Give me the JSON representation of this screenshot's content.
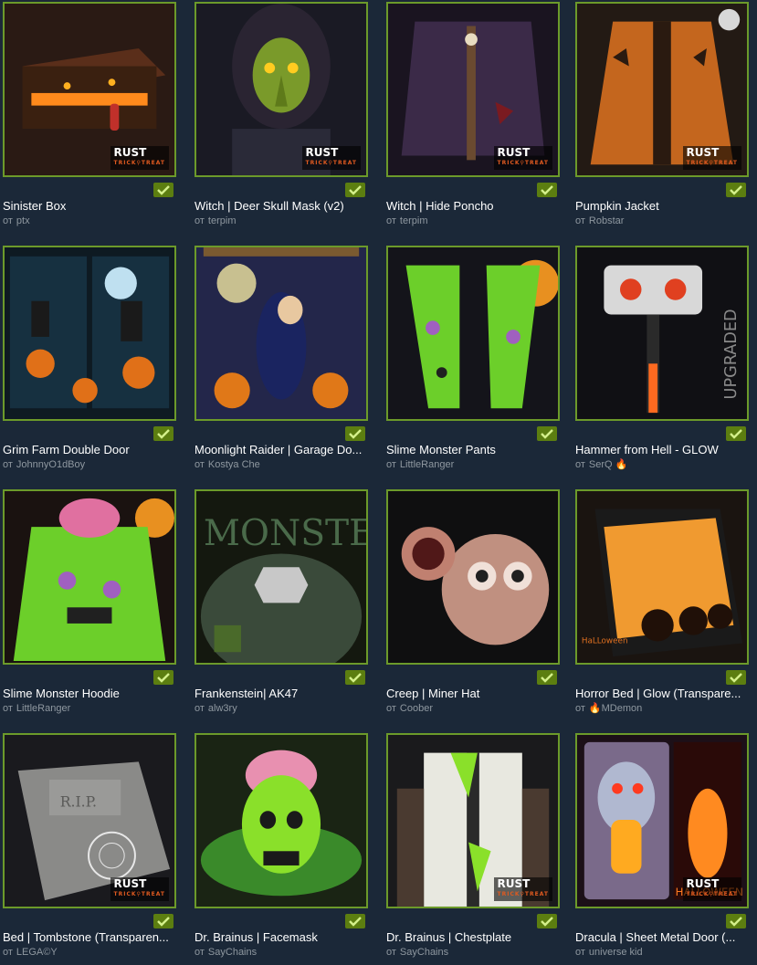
{
  "items": [
    {
      "title": "Sinister Box",
      "by": "от",
      "author": "ptx",
      "flame": "",
      "badge": true,
      "theme": "box"
    },
    {
      "title": "Witch | Deer Skull Mask (v2)",
      "by": "от",
      "author": "terpim",
      "flame": "",
      "badge": true,
      "theme": "witch"
    },
    {
      "title": "Witch | Hide Poncho",
      "by": "от",
      "author": "terpim",
      "flame": "",
      "badge": true,
      "theme": "poncho"
    },
    {
      "title": "Pumpkin Jacket",
      "by": "от",
      "author": "Robstar",
      "flame": "",
      "badge": true,
      "theme": "jacket"
    },
    {
      "title": "Grim Farm Double Door",
      "by": "от",
      "author": "JohnnyO1dBoy",
      "flame": "",
      "badge": false,
      "theme": "door"
    },
    {
      "title": "Moonlight Raider | Garage Do...",
      "by": "от",
      "author": "Kostya Che",
      "flame": "",
      "badge": false,
      "theme": "garage"
    },
    {
      "title": "Slime Monster Pants",
      "by": "от",
      "author": "LittleRanger",
      "flame": "",
      "badge": false,
      "theme": "pants"
    },
    {
      "title": "Hammer from Hell - GLOW",
      "by": "от",
      "author": "SerQ",
      "flame": "🔥",
      "badge": false,
      "theme": "hammer"
    },
    {
      "title": "Slime Monster Hoodie",
      "by": "от",
      "author": "LittleRanger",
      "flame": "",
      "badge": false,
      "theme": "hoodie"
    },
    {
      "title": "Frankenstein| AK47",
      "by": "от",
      "author": "alw3ry",
      "flame": "",
      "badge": false,
      "theme": "ak"
    },
    {
      "title": "Creep | Miner Hat",
      "by": "от",
      "author": "Coober",
      "flame": "",
      "badge": false,
      "theme": "hat"
    },
    {
      "title": "Horror Bed | Glow (Transpare...",
      "by": "от",
      "author": "🔥MDemon",
      "flame": "",
      "badge": false,
      "theme": "bed"
    },
    {
      "title": "Bed | Tombstone (Transparen...",
      "by": "от",
      "author": "LEGA©Y",
      "flame": "",
      "badge": true,
      "theme": "tomb"
    },
    {
      "title": "Dr. Brainus | Facemask",
      "by": "от",
      "author": "SayChains",
      "flame": "",
      "badge": false,
      "theme": "facemask"
    },
    {
      "title": "Dr. Brainus | Chestplate",
      "by": "от",
      "author": "SayChains",
      "flame": "",
      "badge": true,
      "theme": "chest"
    },
    {
      "title": "Dracula | Sheet Metal Door (...",
      "by": "от",
      "author": "universe kid",
      "flame": "",
      "badge": true,
      "theme": "dracula"
    }
  ],
  "badge": {
    "top": "RUST",
    "bottom": "TRICK⚲TREAT"
  },
  "colors": {
    "background": "#1b2838",
    "border": "#6c9a2a",
    "check": "#5c7e10",
    "author": "#8f98a0"
  }
}
